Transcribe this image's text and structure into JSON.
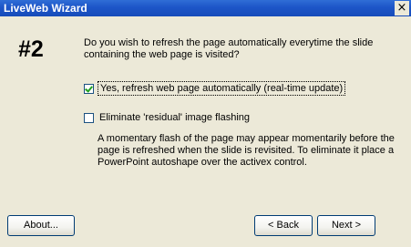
{
  "window": {
    "title": "LiveWeb Wizard",
    "close_label": "×"
  },
  "step": {
    "number": "#2",
    "question": "Do you wish to refresh the page automatically everytime the slide containing the web page is visited?"
  },
  "options": {
    "auto_refresh": {
      "label": "Yes, refresh web page automatically (real-time update)",
      "checked": true
    },
    "eliminate_flashing": {
      "label": "Eliminate 'residual' image flashing",
      "checked": false
    }
  },
  "note": "A momentary flash of the page may appear momentarily before the page is refreshed when the slide is revisited. To eliminate it place a PowerPoint autoshape over the activex control.",
  "buttons": {
    "about": "About...",
    "back": "< Back",
    "next": "Next >"
  }
}
